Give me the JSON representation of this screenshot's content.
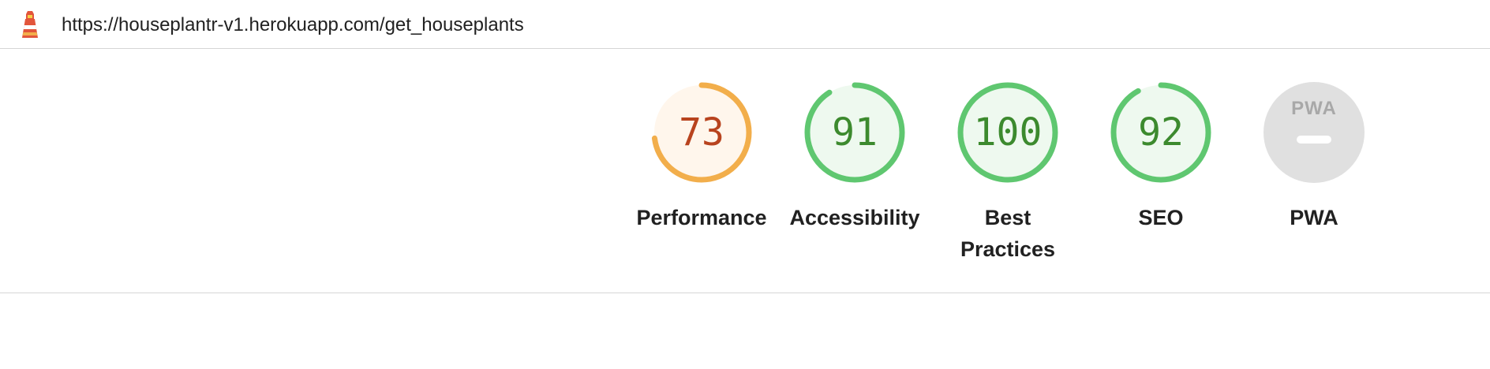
{
  "header": {
    "url": "https://houseplantr-v1.herokuapp.com/get_houseplants",
    "logo_icon": "lighthouse-icon"
  },
  "colors": {
    "pass": "#0cce6b",
    "pass_ring": "#5fc770",
    "pass_fill": "#eef9ef",
    "pass_text": "#3c8a2e",
    "average_ring": "#f2ae4b",
    "average_fill": "#fff6ec",
    "average_text": "#b8431e",
    "na_fill": "#e0e0e0",
    "na_text": "#a8a8a8"
  },
  "gauges": [
    {
      "label": "Performance",
      "score": "73",
      "value": 73,
      "rating": "average"
    },
    {
      "label": "Accessibility",
      "score": "91",
      "value": 91,
      "rating": "pass"
    },
    {
      "label": "Best Practices",
      "score": "100",
      "value": 100,
      "rating": "pass"
    },
    {
      "label": "SEO",
      "score": "92",
      "value": 92,
      "rating": "pass"
    },
    {
      "label": "PWA",
      "score": "",
      "badge": "PWA",
      "rating": "na"
    }
  ]
}
